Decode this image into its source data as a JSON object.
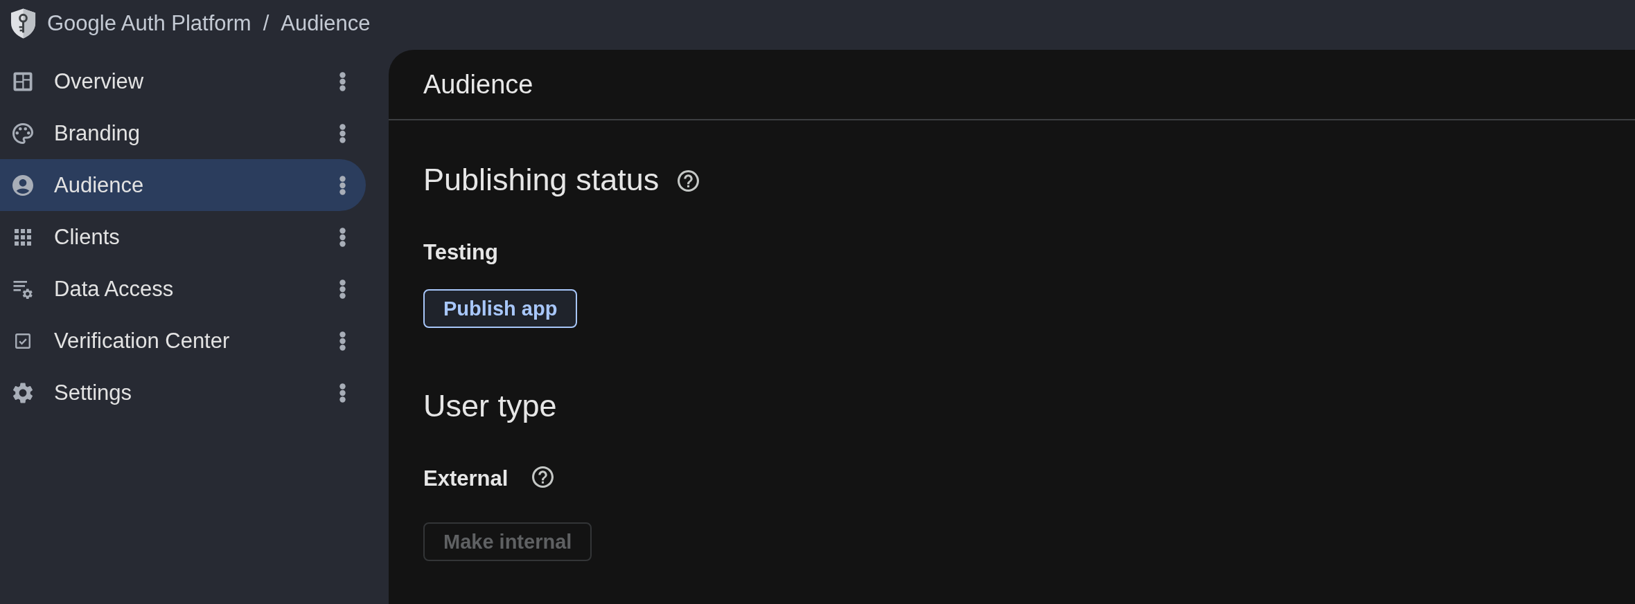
{
  "header": {
    "breadcrumbs": [
      "Google Auth Platform",
      "Audience"
    ],
    "separator": "/"
  },
  "sidebar": {
    "items": [
      {
        "label": "Overview",
        "selected": false
      },
      {
        "label": "Branding",
        "selected": false
      },
      {
        "label": "Audience",
        "selected": true
      },
      {
        "label": "Clients",
        "selected": false
      },
      {
        "label": "Data Access",
        "selected": false
      },
      {
        "label": "Verification Center",
        "selected": false
      },
      {
        "label": "Settings",
        "selected": false
      }
    ]
  },
  "page": {
    "title": "Audience",
    "sections": [
      {
        "title": "Publishing status",
        "title_help": true,
        "status": "Testing",
        "button": {
          "label": "Publish app",
          "disabled": false
        }
      },
      {
        "title": "User type",
        "status": "External",
        "status_help": true,
        "button": {
          "label": "Make internal",
          "disabled": true
        }
      }
    ]
  }
}
